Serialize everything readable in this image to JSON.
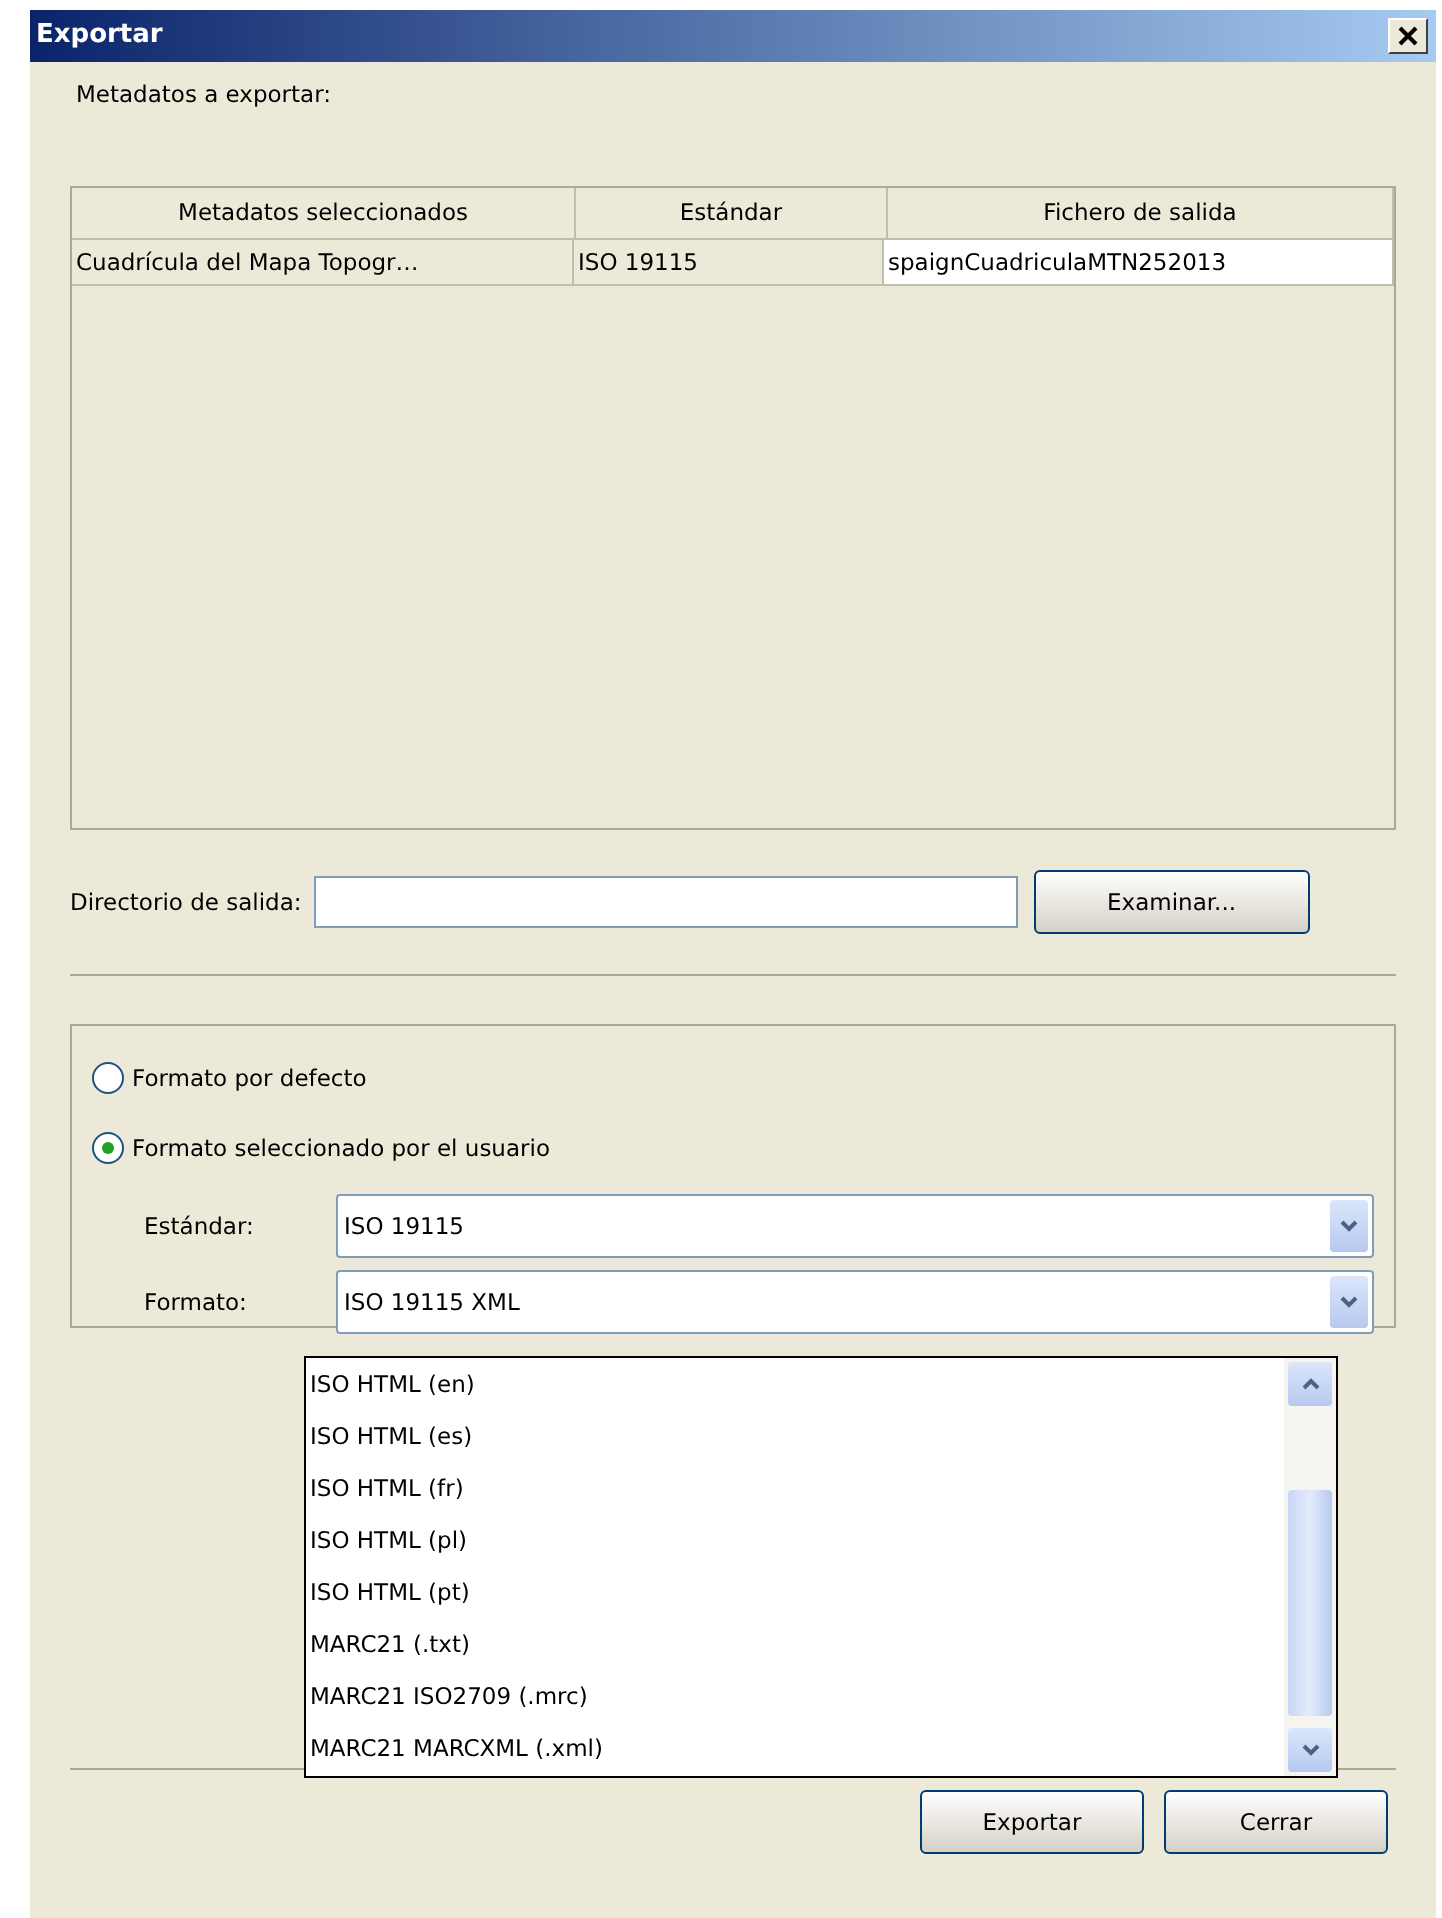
{
  "window": {
    "title": "Exportar"
  },
  "metadata_label": "Metadatos a exportar:",
  "table": {
    "columns": [
      "Metadatos seleccionados",
      "Estándar",
      "Fichero de salida"
    ],
    "rows": [
      [
        "Cuadrícula del Mapa Topogr…",
        "ISO 19115",
        "spaignCuadriculaMTN252013"
      ]
    ]
  },
  "output_dir": {
    "label": "Directorio de salida:",
    "browse_button": "Examinar..."
  },
  "format_options": [
    {
      "label": "Formato por defecto",
      "selected": false
    },
    {
      "label": "Formato seleccionado por el usuario",
      "selected": true
    }
  ],
  "standard": {
    "label": "Estándar:",
    "value": "ISO 19115"
  },
  "format": {
    "label": "Formato:",
    "value": "ISO 19115 XML"
  },
  "format_dropdown": [
    "ISO HTML (en)",
    "ISO HTML (es)",
    "ISO HTML (fr)",
    "ISO HTML (pl)",
    "ISO HTML (pt)",
    "MARC21 (.txt)",
    "MARC21 ISO2709 (.mrc)",
    "MARC21 MARCXML (.xml)"
  ],
  "buttons": [
    "Exportar",
    "Cerrar"
  ]
}
